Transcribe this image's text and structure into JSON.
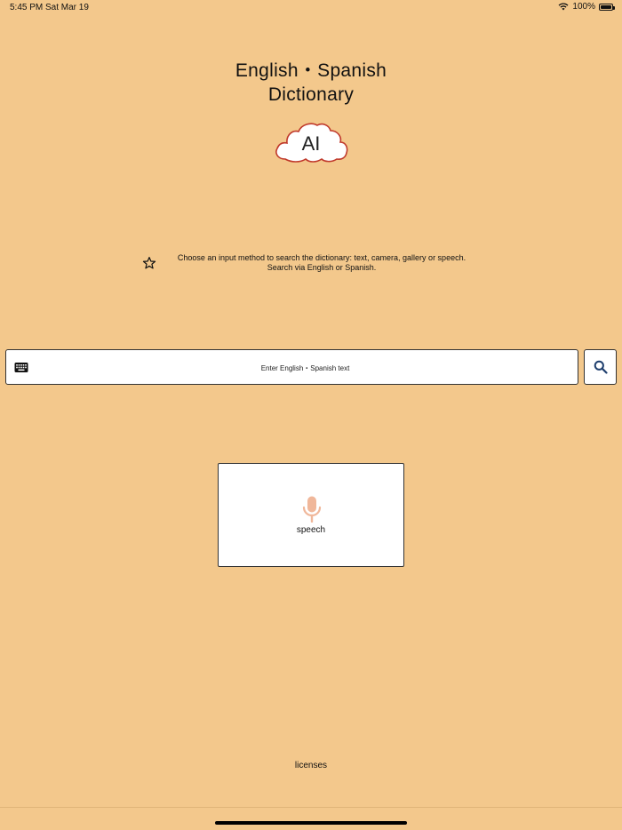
{
  "status_bar": {
    "time": "5:45 PM",
    "date": "Sat Mar 19",
    "battery": "100%",
    "wifi_icon": "wifi-icon",
    "battery_icon": "battery-icon"
  },
  "header": {
    "title_line1": "English・Spanish",
    "title_line2": "Dictionary",
    "logo_text": "AI",
    "logo_icon": "cloud-icon"
  },
  "hint": {
    "icon": "star-icon",
    "line1": "Choose an input method to search the dictionary: text, camera, gallery or speech.",
    "line2": "Search via English or Spanish."
  },
  "search": {
    "placeholder": "Enter English・Spanish text",
    "value": "",
    "keyboard_icon": "keyboard-icon",
    "button_icon": "search-icon"
  },
  "input_methods": {
    "speech": {
      "label": "speech",
      "icon": "microphone-icon"
    }
  },
  "footer": {
    "licenses": "licenses"
  },
  "colors": {
    "background": "#f3c88c",
    "logo_outline": "#c0392b",
    "mic": "#f0b79a",
    "search_icon": "#1f3f6e"
  }
}
